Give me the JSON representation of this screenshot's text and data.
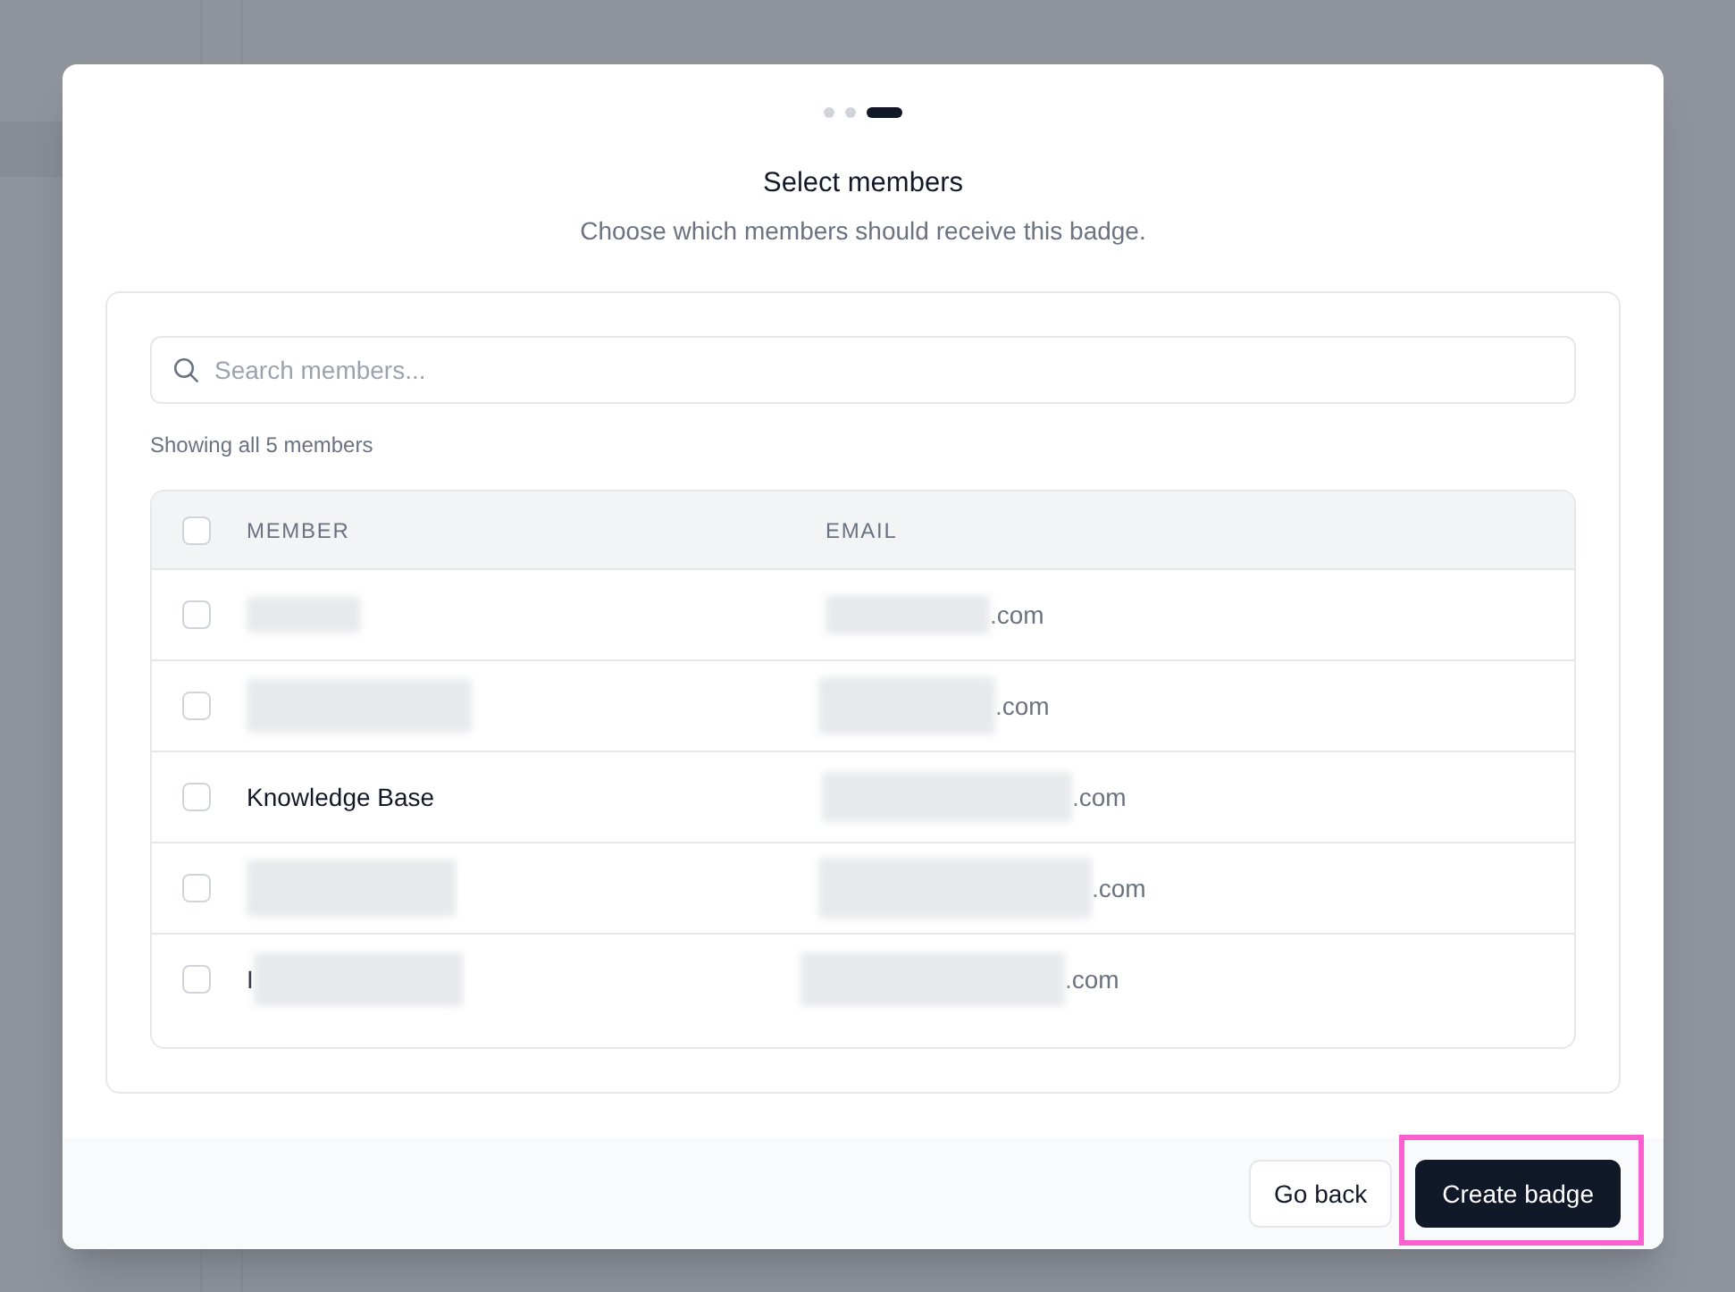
{
  "dialog": {
    "steps": [
      {
        "selected": false
      },
      {
        "selected": false
      },
      {
        "selected": true
      }
    ],
    "title": "Select members",
    "subtitle": "Choose which members should receive this badge.",
    "search": {
      "placeholder": "Search members..."
    },
    "count_text": "Showing all 5 members",
    "table": {
      "select_all": {
        "checked": false
      },
      "columns": [
        "MEMBER",
        "EMAIL"
      ],
      "rows": [
        {
          "checked": false,
          "name_redacted": true,
          "email": ".com",
          "email_redacted": true
        },
        {
          "checked": false,
          "name_redacted": true,
          "email": ".com",
          "email_redacted": true
        },
        {
          "checked": false,
          "name": "Knowledge Base",
          "name_redacted": false,
          "email": ".com",
          "email_redacted": true
        },
        {
          "checked": false,
          "name_redacted": true,
          "email": ".com",
          "email_redacted": true
        },
        {
          "checked": false,
          "name": "I",
          "name_redacted": true,
          "email": ".com",
          "email_redacted": true
        }
      ]
    },
    "buttons": [
      {
        "kind": "secondary",
        "label": "Go back",
        "highlighted": false
      },
      {
        "kind": "primary",
        "label": "Create badge",
        "highlighted": true
      }
    ]
  }
}
